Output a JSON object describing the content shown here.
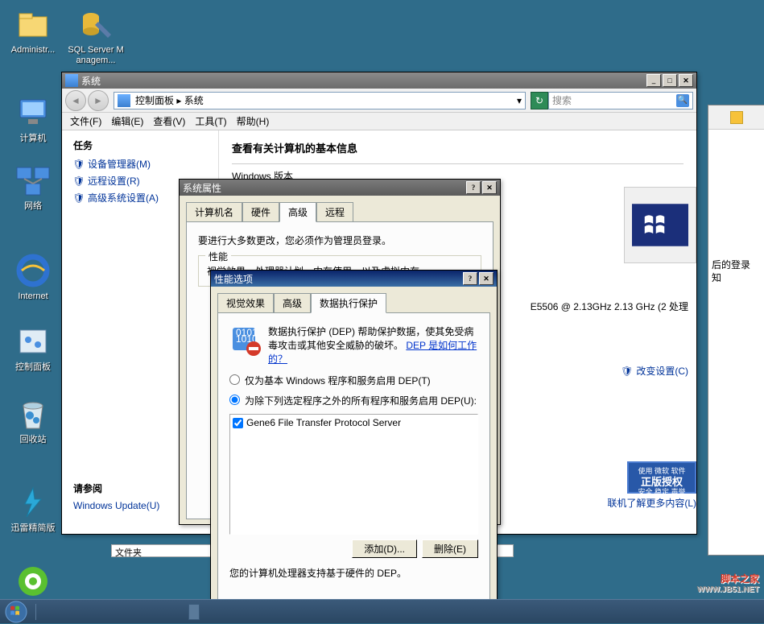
{
  "desktop": {
    "icons": [
      {
        "label": "Administr..."
      },
      {
        "label": "SQL Server Managem..."
      },
      {
        "label": "计算机"
      },
      {
        "label": "网络"
      },
      {
        "label": "Internet"
      },
      {
        "label": "控制面板"
      },
      {
        "label": "回收站"
      },
      {
        "label": "迅雷精简版"
      }
    ]
  },
  "system_window": {
    "title": "系统",
    "address": "控制面板 ▸ 系统",
    "search_placeholder": "搜索",
    "menu": {
      "file": "文件(F)",
      "edit": "编辑(E)",
      "view": "查看(V)",
      "tools": "工具(T)",
      "help": "帮助(H)"
    },
    "tasks_header": "任务",
    "task_links": {
      "devmgr": "设备管理器(M)",
      "remote": "远程设置(R)",
      "advanced": "高级系统设置(A)"
    },
    "see_also_header": "请参阅",
    "see_also_link": "Windows Update(U)",
    "heading": "查看有关计算机的基本信息",
    "section_windows": "Windows 版本",
    "cpu": "E5506  @ 2.13GHz   2.13 GHz  (2 处理",
    "change_settings": "改变设置(C)",
    "genuine_line1": "使用 微软 软件",
    "genuine_line2": "正版授权",
    "genuine_line3": "安全 稳定 声誉",
    "learn_more": "联机了解更多内容(L)",
    "folder_label": "文件夹"
  },
  "right_panel": {
    "login_tail": "后的登录",
    "unknown": "知"
  },
  "props_dialog": {
    "title": "系统属性",
    "tabs": {
      "computer": "计算机名",
      "hardware": "硬件",
      "advanced": "高级",
      "remote": "远程"
    },
    "admin_note": "要进行大多数更改，您必须作为管理员登录。",
    "perf_group": "性能",
    "perf_desc": "视觉效果，处理器计划，内存使用，以及虚拟内存"
  },
  "perf_dialog": {
    "title": "性能选项",
    "tabs": {
      "visual": "视觉效果",
      "advanced": "高级",
      "dep": "数据执行保护"
    },
    "dep_desc_1": "数据执行保护 (DEP) 帮助保护数据，使其免受病毒攻击或其他安全威胁的破坏。",
    "dep_link": "DEP 是如何工作的？",
    "radio_basic": "仅为基本 Windows 程序和服务启用 DEP(T)",
    "radio_all": "为除下列选定程序之外的所有程序和服务启用 DEP(U):",
    "list_item": "Gene6 File Transfer Protocol Server",
    "add_btn": "添加(D)...",
    "remove_btn": "删除(E)",
    "footnote": "您的计算机处理器支持基于硬件的 DEP。"
  },
  "watermark": {
    "brand": "脚本之家",
    "url": "WWW.JB51.NET"
  }
}
